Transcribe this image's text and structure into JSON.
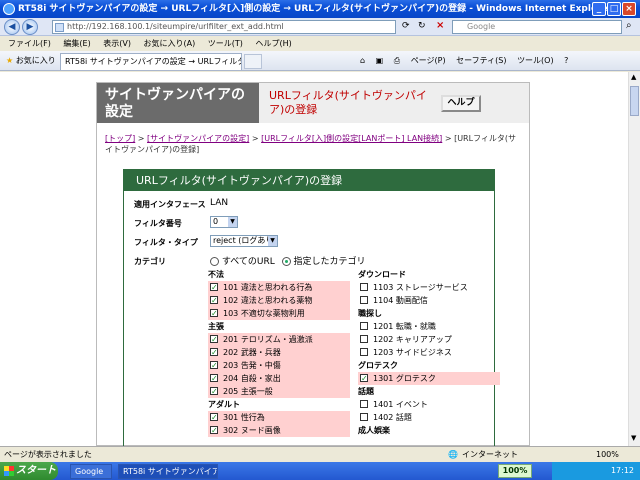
{
  "window": {
    "title": "RT58i サイトヴァンパイアの設定 → URLフィルタ[入]側の設定 → URLフィルタ(サイトヴァンパイア)の登録 - Windows Internet Explorer"
  },
  "address": {
    "url": "http://192.168.100.1/siteumpire/urlfilter_ext_add.html",
    "search_placeholder": "Google"
  },
  "menu": [
    "ファイル(F)",
    "編集(E)",
    "表示(V)",
    "お気に入り(A)",
    "ツール(T)",
    "ヘルプ(H)"
  ],
  "favorites": {
    "label": "お気に入り"
  },
  "tab": {
    "label": "RT58i サイトヴァンパイアの設定 → URLフィルタ[入]側の..."
  },
  "commands": [
    "ページ(P)",
    "セーフティ(S)",
    "ツール(O)"
  ],
  "page": {
    "title": "サイトヴァンパイアの設定",
    "subtitle": "URLフィルタ(サイトヴァンパイア)の登録",
    "help": "ヘルプ",
    "breadcrumb": {
      "top": "[トップ]",
      "sep": ">",
      "settings": "[サイトヴァンパイアの設定]",
      "filter": "[URLフィルタ[入]側の設定[LANポート] LAN接続]",
      "current": "> [URLフィルタ(サイトヴァンパイア)の登録]"
    },
    "form": {
      "header": "URLフィルタ(サイトヴァンパイア)の登録",
      "interface_label": "適用インタフェース",
      "interface_value": "LAN",
      "number_label": "フィルタ番号",
      "number_value": "0",
      "type_label": "フィルタ・タイプ",
      "type_value": "reject (ログあり)",
      "category_label": "カテゴリ",
      "radio_all": "すべてのURL",
      "radio_selected": "指定したカテゴリ"
    },
    "left_groups": [
      {
        "name": "不法",
        "items": [
          {
            "label": "101 違法と思われる行為",
            "checked": true
          },
          {
            "label": "102 違法と思われる薬物",
            "checked": true
          },
          {
            "label": "103 不適切な薬物利用",
            "checked": true
          }
        ]
      },
      {
        "name": "主張",
        "items": [
          {
            "label": "201 テロリズム・過激派",
            "checked": true
          },
          {
            "label": "202 武器・兵器",
            "checked": true
          },
          {
            "label": "203 告発・中傷",
            "checked": true
          },
          {
            "label": "204 自殺・家出",
            "checked": true
          },
          {
            "label": "205 主張一般",
            "checked": true
          }
        ]
      },
      {
        "name": "アダルト",
        "items": [
          {
            "label": "301 性行為",
            "checked": true
          },
          {
            "label": "302 ヌード画像",
            "checked": true
          }
        ]
      }
    ],
    "right_groups": [
      {
        "name": "ダウンロード",
        "items": [
          {
            "label": "1103 ストレージサービス",
            "checked": false
          },
          {
            "label": "1104 動画配信",
            "checked": false
          }
        ]
      },
      {
        "name": "職探し",
        "items": [
          {
            "label": "1201 転職・就職",
            "checked": false
          },
          {
            "label": "1202 キャリアアップ",
            "checked": false
          },
          {
            "label": "1203 サイドビジネス",
            "checked": false
          }
        ]
      },
      {
        "name": "グロテスク",
        "items": [
          {
            "label": "1301 グロテスク",
            "checked": true
          }
        ]
      },
      {
        "name": "話題",
        "items": [
          {
            "label": "1401 イベント",
            "checked": false
          },
          {
            "label": "1402 話題",
            "checked": false
          }
        ]
      },
      {
        "name": "成人娯楽",
        "items": []
      }
    ]
  },
  "statusbar": {
    "text": "ページが表示されました",
    "zone": "インターネット",
    "zoom": "100%"
  },
  "taskbar": {
    "start": "スタート",
    "google": "Google",
    "ie": "RT58i サイトヴァンパイア...",
    "clock": "17:12",
    "badge": "100%"
  }
}
